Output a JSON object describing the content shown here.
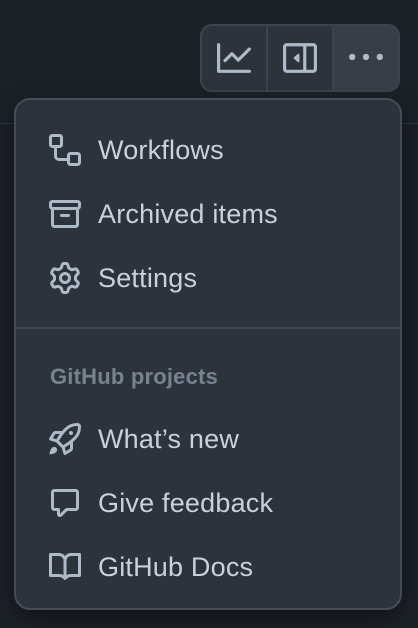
{
  "toolbar": {
    "buttons": [
      {
        "icon": "graph-icon"
      },
      {
        "icon": "sidebar-panel-icon"
      },
      {
        "icon": "kebab-horizontal-icon"
      }
    ]
  },
  "menu": {
    "items": [
      {
        "label": "Workflows",
        "icon": "workflow-icon"
      },
      {
        "label": "Archived items",
        "icon": "archive-icon"
      },
      {
        "label": "Settings",
        "icon": "gear-icon"
      }
    ],
    "section": {
      "heading": "GitHub projects",
      "items": [
        {
          "label": "What’s new",
          "icon": "rocket-icon"
        },
        {
          "label": "Give feedback",
          "icon": "comment-icon"
        },
        {
          "label": "GitHub Docs",
          "icon": "book-icon"
        }
      ]
    }
  },
  "colors": {
    "page_background": "#1c2128",
    "menu_background": "#2d333b",
    "text": "#c9d1d9",
    "muted_text": "#768390",
    "border": "#444c56"
  }
}
